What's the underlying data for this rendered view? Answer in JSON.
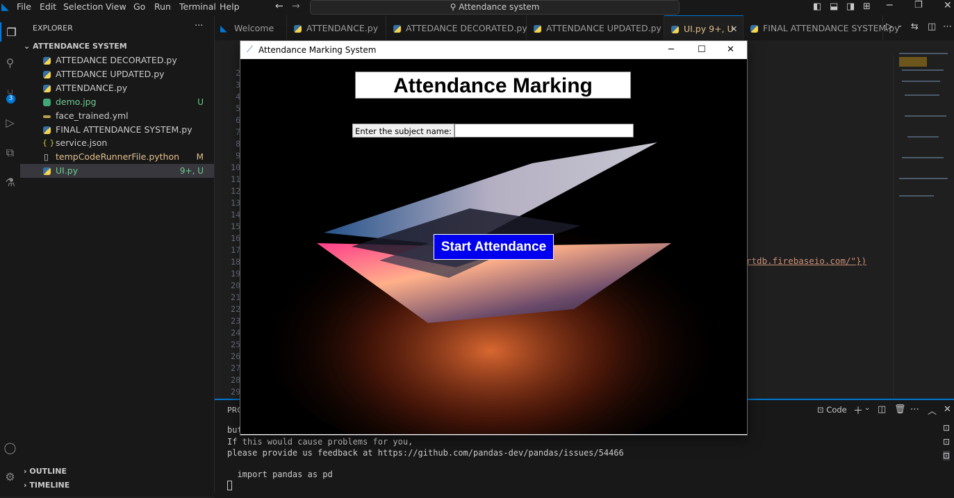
{
  "menubar": {
    "items": [
      "File",
      "Edit",
      "Selection",
      "View",
      "Go",
      "Run",
      "Terminal",
      "Help"
    ],
    "search": "Attendance system"
  },
  "explorer": {
    "header": "EXPLORER",
    "more": "···",
    "folder": "ATTENDANCE SYSTEM",
    "files": [
      {
        "name": "ATTEDANCE DECORATED.py",
        "badge": ""
      },
      {
        "name": "ATTEDANCE UPDATED.py",
        "badge": ""
      },
      {
        "name": "ATTENDANCE.py",
        "badge": ""
      },
      {
        "name": "demo.jpg",
        "badge": "U"
      },
      {
        "name": "face_trained.yml",
        "badge": ""
      },
      {
        "name": "FINAL ATTENDANCE SYSTEM.py",
        "badge": ""
      },
      {
        "name": "service.json",
        "badge": ""
      },
      {
        "name": "tempCodeRunnerFile.python",
        "badge": "M"
      },
      {
        "name": "UI.py",
        "badge": "9+, U"
      }
    ],
    "outline": "OUTLINE",
    "timeline": "TIMELINE"
  },
  "tabs": [
    "Welcome",
    "ATTENDANCE.py",
    "ATTEDANCE DECORATED.py",
    "ATTENDANCE UPDATED.py",
    "UI.py 9+, U",
    "FINAL ATTENDANCE SYSTEM.py"
  ],
  "source_control_badge": "3",
  "editor": {
    "line_numbers": [
      "2",
      "3",
      "4",
      "5",
      "6",
      "7",
      "8",
      "9",
      "10",
      "11",
      "12",
      "13",
      "14",
      "15",
      "16",
      "17",
      "18",
      "19",
      "20",
      "21",
      "22",
      "23",
      "24",
      "25",
      "26",
      "27",
      "28",
      "29"
    ],
    "visible_code": "rtdb.firebaseio.com/\"})"
  },
  "panel": {
    "tab_label": "PRO",
    "terminal_label": "Code",
    "lines": [
      "but",
      "If this would cause problems for you,",
      "please provide us feedback at https://github.com/pandas-dev/pandas/issues/54466",
      "",
      "  import pandas as pd"
    ]
  },
  "app_window": {
    "title": "Attendance Marking System",
    "heading": "Attendance Marking System",
    "subject_label": "Enter the subject name:",
    "subject_value": "",
    "button": "Start Attendance"
  },
  "colors": {
    "accent": "#0078d4",
    "button": "#0000ee"
  }
}
